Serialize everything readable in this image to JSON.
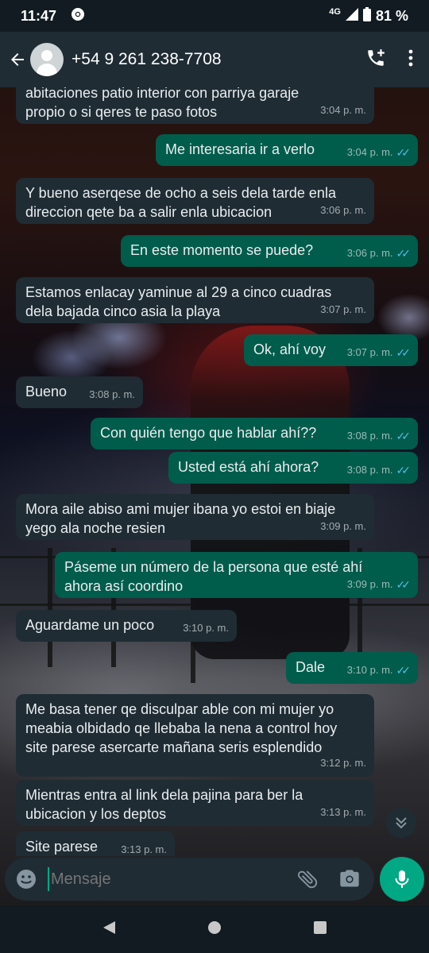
{
  "status_bar": {
    "time": "11:47",
    "network": "4G",
    "battery": "81 %"
  },
  "header": {
    "contact": "+54 9 261 238-7708",
    "icons": [
      "back-arrow-icon",
      "avatar",
      "add-call-icon",
      "more-vert-icon"
    ]
  },
  "messages": [
    {
      "dir": "in",
      "text": "abitaciones patio interior con parriya garaje\npropio o si qeres te paso fotos",
      "time": "3:04 p. m."
    },
    {
      "dir": "out",
      "text": "Me interesaria ir a verlo",
      "time": "3:04 p. m."
    },
    {
      "dir": "in",
      "text": "Y bueno aserqese de ocho a seis dela tarde enla\ndireccion qete ba a salir enla ubicacion",
      "time": "3:06 p. m."
    },
    {
      "dir": "out",
      "text": "En este momento se puede?",
      "time": "3:06 p. m."
    },
    {
      "dir": "in",
      "text": "Estamos enlacay yaminue al 29 a cinco cuadras\ndela  bajada cinco asia la playa",
      "time": "3:07 p. m."
    },
    {
      "dir": "out",
      "text": "Ok, ahí voy",
      "time": "3:07 p. m."
    },
    {
      "dir": "in",
      "text": "Bueno",
      "time": "3:08 p. m."
    },
    {
      "dir": "out",
      "text": "Con quién tengo que hablar ahí??",
      "time": "3:08 p. m."
    },
    {
      "dir": "out",
      "text": "Usted está ahí ahora?",
      "time": "3:08 p. m."
    },
    {
      "dir": "in",
      "text": "Mora aile abiso ami mujer ibana yo estoi en biaje\nyego ala noche resien",
      "time": "3:09 p. m."
    },
    {
      "dir": "out",
      "text": "Páseme un número de la persona que esté ahí\nahora así coordino",
      "time": "3:09 p. m."
    },
    {
      "dir": "in",
      "text": "Aguardame un poco",
      "time": "3:10 p. m."
    },
    {
      "dir": "out",
      "text": "Dale",
      "time": "3:10 p. m."
    },
    {
      "dir": "in",
      "text": "Me basa tener qe disculpar able con  mi mujer yo\nmeabia olbidado qe llebaba la nena a control hoy\nsite parese asercarte mañana seris esplendido",
      "time": "3:12 p. m."
    },
    {
      "dir": "in",
      "text": "Mientras entra al link dela pajina para ber la\nubicacion y los deptos",
      "time": "3:13 p. m."
    },
    {
      "dir": "in",
      "text": "Site parese",
      "time": "3:13 p. m."
    }
  ],
  "composer": {
    "placeholder": "Mensaje"
  },
  "colors": {
    "incoming_bubble": "#1f2c34",
    "outgoing_bubble": "#005c4b",
    "read_ticks": "#53bdeb",
    "accent": "#00a884"
  }
}
